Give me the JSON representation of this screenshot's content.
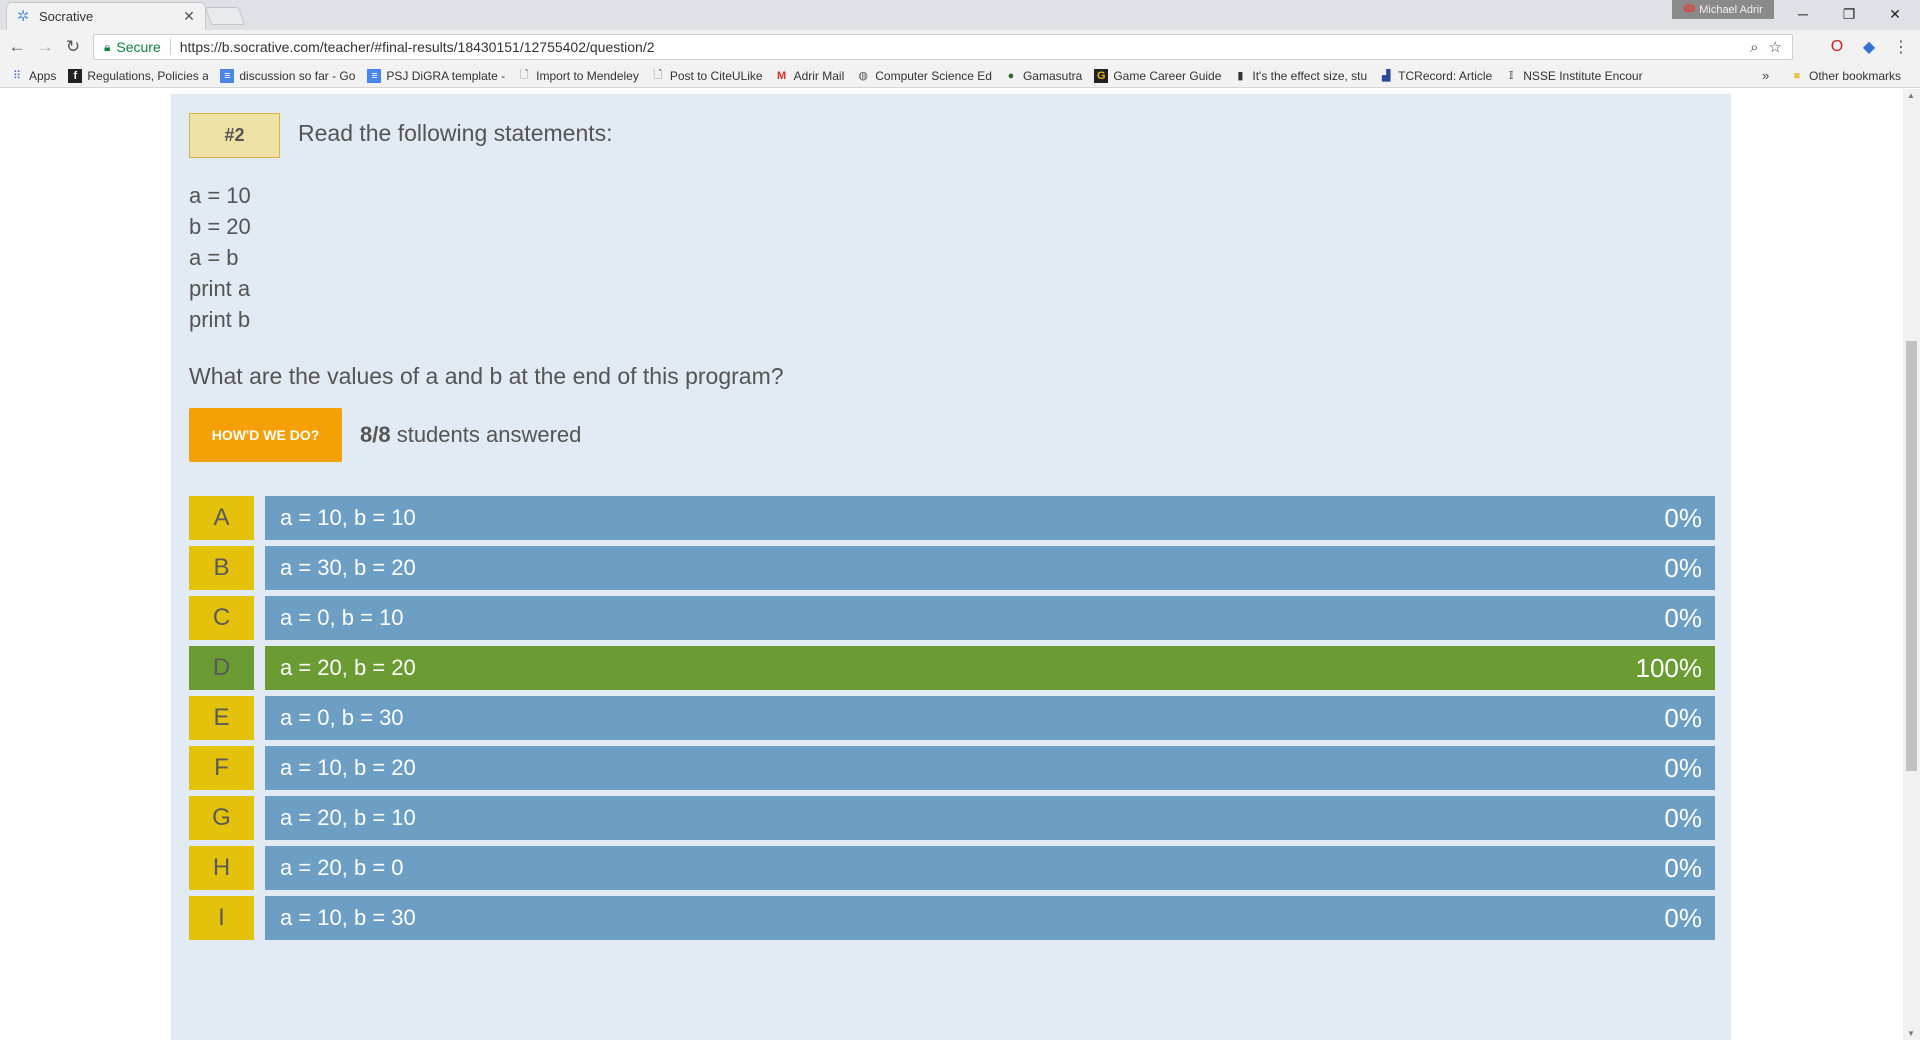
{
  "browser": {
    "tab_title": "Socrative",
    "tab_close": "✕",
    "profile_name": "Michael Adrir",
    "secure_label": "Secure",
    "url": "https://b.socrative.com/teacher/#final-results/18430151/12755402/question/2"
  },
  "bookmarks": [
    {
      "label": "Apps",
      "icon": "apps-grid-icon"
    },
    {
      "label": "Regulations, Policies a",
      "icon": "page-icon"
    },
    {
      "label": "discussion so far - Go",
      "icon": "doc-icon"
    },
    {
      "label": "PSJ DiGRA template -",
      "icon": "doc-icon"
    },
    {
      "label": "Import to Mendeley",
      "icon": "page-icon"
    },
    {
      "label": "Post to CiteULike",
      "icon": "page-icon"
    },
    {
      "label": "Adrir Mail",
      "icon": "gmail-icon"
    },
    {
      "label": "Computer Science Ed",
      "icon": "globe-icon"
    },
    {
      "label": "Gamasutra",
      "icon": "gamasutra-icon"
    },
    {
      "label": "Game Career Guide",
      "icon": "gcg-icon"
    },
    {
      "label": "It's the effect size, stu",
      "icon": "bottle-icon"
    },
    {
      "label": "TCRecord: Article",
      "icon": "tcr-icon"
    },
    {
      "label": "NSSE Institute Encour",
      "icon": "nsse-icon"
    }
  ],
  "other_bookmarks": "Other bookmarks",
  "bookmarks_overflow": "»",
  "question": {
    "number": "#2",
    "prompt": "Read the following statements:",
    "code": [
      "a = 10",
      "b = 20",
      "a = b",
      "print a",
      "print b"
    ],
    "text": "What are the values of a and b at the end of this program?",
    "howd_button": "HOW'D WE DO?",
    "answered_count": "8/8",
    "answered_suffix": " students answered"
  },
  "answers": [
    {
      "letter": "A",
      "text": "a = 10, b = 10",
      "percent_label": "0%",
      "percent": 0,
      "correct": false
    },
    {
      "letter": "B",
      "text": "a = 30, b = 20",
      "percent_label": "0%",
      "percent": 0,
      "correct": false
    },
    {
      "letter": "C",
      "text": "a = 0, b = 10",
      "percent_label": "0%",
      "percent": 0,
      "correct": false
    },
    {
      "letter": "D",
      "text": "a = 20, b = 20",
      "percent_label": "100%",
      "percent": 100,
      "correct": true
    },
    {
      "letter": "E",
      "text": "a = 0, b = 30",
      "percent_label": "0%",
      "percent": 0,
      "correct": false
    },
    {
      "letter": "F",
      "text": "a = 10, b = 20",
      "percent_label": "0%",
      "percent": 0,
      "correct": false
    },
    {
      "letter": "G",
      "text": "a = 20, b = 10",
      "percent_label": "0%",
      "percent": 0,
      "correct": false
    },
    {
      "letter": "H",
      "text": "a = 20, b = 0",
      "percent_label": "0%",
      "percent": 0,
      "correct": false
    },
    {
      "letter": "I",
      "text": "a = 10, b = 30",
      "percent_label": "0%",
      "percent": 0,
      "correct": false
    }
  ],
  "colors": {
    "answer_letter": "#e4c20b",
    "answer_bar": "#6d9fc5",
    "correct": "#6a9c33",
    "button": "#f5a006",
    "panel": "#e2eaf3"
  }
}
